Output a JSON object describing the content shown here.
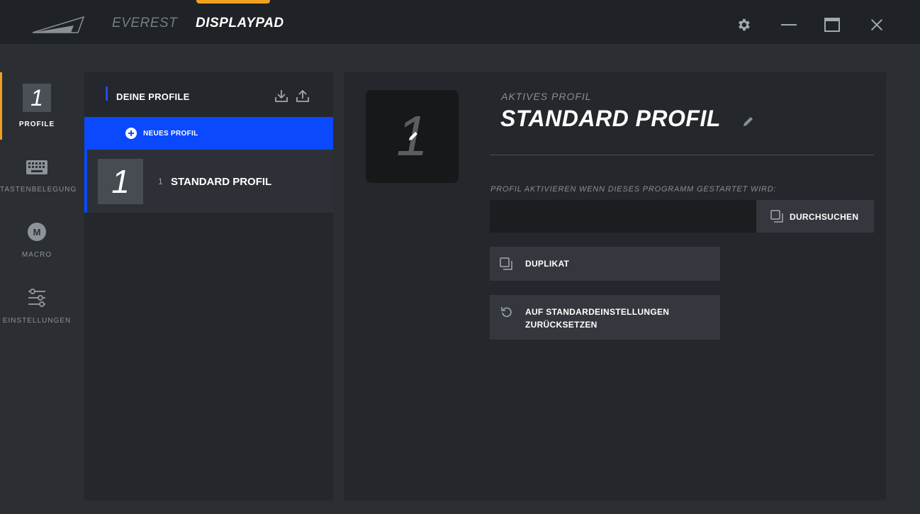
{
  "titlebar": {
    "tabs": {
      "everest": "EVEREST",
      "displaypad": "DISPLAYPAD"
    },
    "active_tab": "DISPLAYPAD",
    "accent_color": "#f0a020",
    "window_controls": [
      "gear-icon",
      "minimize-icon",
      "maximize-icon",
      "close-icon"
    ]
  },
  "sidebar": {
    "items": [
      {
        "label": "PROFILE",
        "thumb": "1",
        "active": true
      },
      {
        "label": "TASTENBELEGUNG",
        "icon": "keyboard-icon"
      },
      {
        "label": "MACRO",
        "icon": "macro-icon",
        "badge": "M"
      },
      {
        "label": "EINSTELLUNGEN",
        "icon": "sliders-icon"
      }
    ]
  },
  "profiles": {
    "title": "DEINE PROFILE",
    "new_profile_label": "NEUES PROFIL",
    "list": [
      {
        "number": "1",
        "thumb": "1",
        "name": "STANDARD PROFIL",
        "selected": true
      }
    ],
    "selection_color": "#0b49ff"
  },
  "details": {
    "thumb_digit": "1",
    "active_label": "AKTIVES PROFIL",
    "active_name": "STANDARD PROFIL",
    "launch_label": "PROFIL AKTIVIEREN WENN DIESES PROGRAMM GESTARTET WIRD:",
    "launch_value": "",
    "browse_label": "DURCHSUCHEN",
    "duplicate_label": "DUPLIKAT",
    "reset_label": "AUF STANDARDEINSTELLUNGEN ZURÜCKSETZEN"
  }
}
